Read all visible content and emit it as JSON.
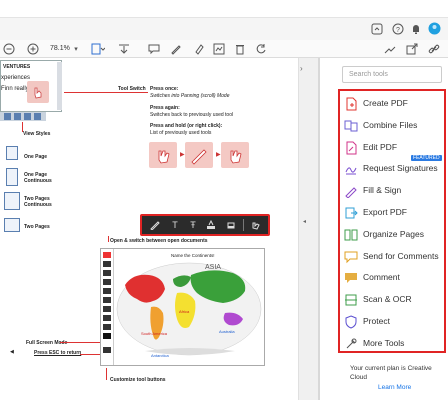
{
  "topbar": {
    "home_icon": "home-icon",
    "help_icon": "help-icon",
    "notification_icon": "bell-icon",
    "avatar_icon": "avatar-icon"
  },
  "toolbar": {
    "zoom_value": "78.1%"
  },
  "document": {
    "thumb_heading": "VENTURES",
    "thumb_line1": "xperiences",
    "thumb_line2": "Finn really",
    "tool_switch_label": "Tool Switch",
    "press_once_title": "Press once:",
    "press_once_text": "Switches into Panning (scroll) Mode",
    "press_again_title": "Press again:",
    "press_again_text": "Switches back to previously used tool",
    "press_hold_title": "Press and hold (or right click):",
    "press_hold_text": "List of previously used tools",
    "view_styles_label": "View Styles",
    "view_one_page": "One Page",
    "view_one_page_cont_1": "One Page",
    "view_one_page_cont_2": "Continuous",
    "view_two_pages_1": "Two Pages",
    "view_two_pages_2": "Continuous",
    "view_two_pages_3": "Two Pages",
    "open_switch_text": "Open & switch between open documents",
    "map_title": "Name the Continents!",
    "map_label_asia": "ASIA",
    "map_label_africa": "Africa",
    "map_label_south_america": "South America",
    "map_label_australia": "Australia",
    "map_label_antarctica": "Antarctica",
    "full_screen_label": "Full Screen Mode",
    "press_esc_label": "Press ESC to return",
    "customize_label": "Customize tool buttons"
  },
  "rightpanel": {
    "search_placeholder": "Search tools",
    "tools": [
      {
        "label": "Create PDF",
        "icon": "create-pdf-icon",
        "color": "#e0342f"
      },
      {
        "label": "Combine Files",
        "icon": "combine-files-icon",
        "color": "#6b5fd3"
      },
      {
        "label": "Edit PDF",
        "icon": "edit-pdf-icon",
        "color": "#d1338a"
      },
      {
        "label": "Request Signatures",
        "icon": "request-signatures-icon",
        "color": "#7a4fd0"
      },
      {
        "label": "Fill & Sign",
        "icon": "fill-sign-icon",
        "color": "#8b48c8"
      },
      {
        "label": "Export PDF",
        "icon": "export-pdf-icon",
        "color": "#2f9fd6"
      },
      {
        "label": "Organize Pages",
        "icon": "organize-pages-icon",
        "color": "#3f9d4b"
      },
      {
        "label": "Send for Comments",
        "icon": "send-comments-icon",
        "color": "#e0a020"
      },
      {
        "label": "Comment",
        "icon": "comment-icon",
        "color": "#e0a020"
      },
      {
        "label": "Scan & OCR",
        "icon": "scan-ocr-icon",
        "color": "#3f9d4b"
      },
      {
        "label": "Protect",
        "icon": "protect-icon",
        "color": "#5b4fd0"
      },
      {
        "label": "More Tools",
        "icon": "more-tools-icon",
        "color": "#555555"
      }
    ],
    "featured_badge": "FEATURED",
    "plan_text": "Your current plan is Creative Cloud",
    "learn_more": "Learn More"
  },
  "colors": {
    "highlight": "#e02424",
    "accent": "#1473e6"
  }
}
